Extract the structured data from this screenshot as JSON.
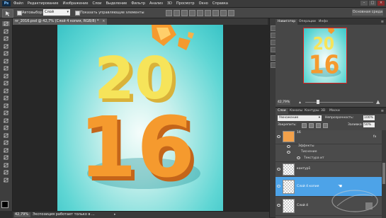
{
  "app": {
    "logo": "Ps"
  },
  "menu": [
    "Файл",
    "Редактирование",
    "Изображение",
    "Слои",
    "Выделение",
    "Фильтр",
    "Анализ",
    "3D",
    "Просмотр",
    "Окно",
    "Справка"
  ],
  "options": {
    "autoselect_label": "Автовыбор:",
    "autoselect_value": "Слой",
    "show_controls_label": "Показать управляющие элементы",
    "workspace": "Основная среда"
  },
  "document": {
    "tab_label": "nr_2016.psd @ 42,7% (Слой 4 копия, RGB/8) *",
    "close": "×"
  },
  "canvas_art": {
    "top_number": "20",
    "bottom_number": "16"
  },
  "status": {
    "zoom": "42,79%",
    "message": "Экспозиция работает только в ...",
    "arrow": "▸"
  },
  "navigator": {
    "tabs": [
      "Навигатор",
      "Операции",
      "Инфо"
    ],
    "menu": "≡",
    "zoom": "42,79%"
  },
  "layers_panel": {
    "tabs": [
      "Слои",
      "Каналы",
      "Контуры",
      "3D",
      "Маски"
    ],
    "menu": "≡",
    "blend_mode": "Умножение",
    "opacity_label": "Непрозрачность:",
    "opacity": "100%",
    "lock_label": "Закрепить:",
    "fill_label": "Заливка:",
    "fill": "50%",
    "layers": [
      {
        "name": "16",
        "fx": "fx"
      },
      {
        "sub": "Эффекты"
      },
      {
        "sub": "Тиснение"
      },
      {
        "sub": "Текстура ит"
      },
      {
        "name": "контур1"
      },
      {
        "name": "Слой 4 копия",
        "selected": true
      },
      {
        "name": "Слой 4"
      }
    ]
  },
  "colors": {
    "accent_selected": "#4da3e8",
    "canvas_bg": "#5fd6d4",
    "number_yellow": "#f6e45a",
    "number_orange": "#f59a2e"
  }
}
